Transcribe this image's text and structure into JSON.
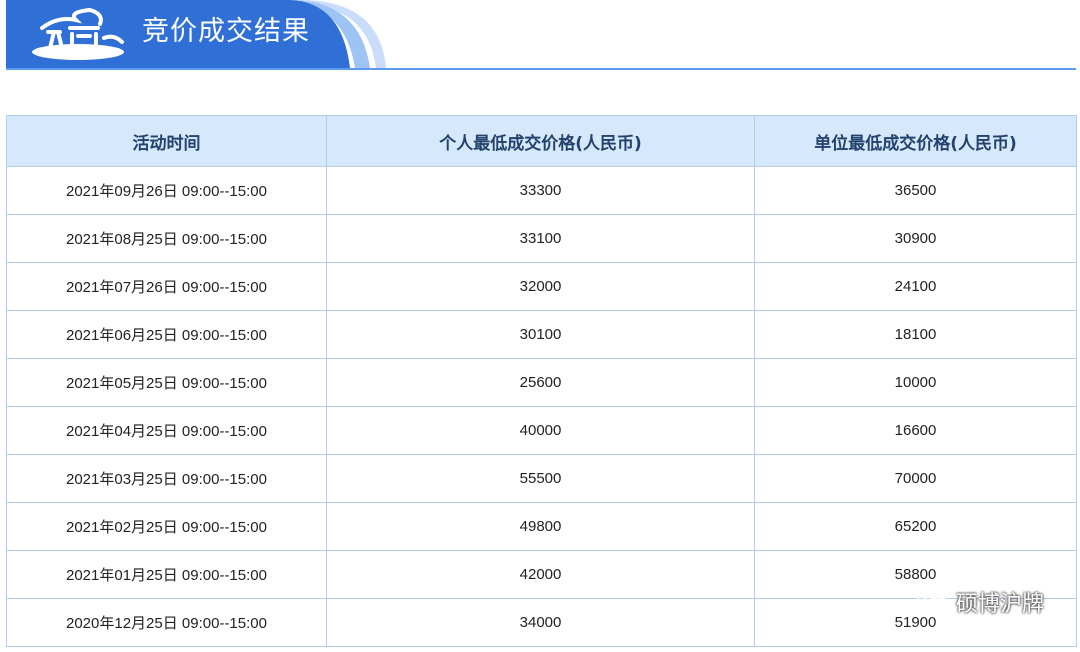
{
  "header": {
    "title": "竞价成交结果"
  },
  "table": {
    "columns": [
      "活动时间",
      "个人最低成交价格(人民币)",
      "单位最低成交价格(人民币)"
    ],
    "rows": [
      [
        "2021年09月26日 09:00--15:00",
        "33300",
        "36500"
      ],
      [
        "2021年08月25日 09:00--15:00",
        "33100",
        "30900"
      ],
      [
        "2021年07月26日 09:00--15:00",
        "32000",
        "24100"
      ],
      [
        "2021年06月25日 09:00--15:00",
        "30100",
        "18100"
      ],
      [
        "2021年05月25日 09:00--15:00",
        "25600",
        "10000"
      ],
      [
        "2021年04月25日 09:00--15:00",
        "40000",
        "16600"
      ],
      [
        "2021年03月25日 09:00--15:00",
        "55500",
        "70000"
      ],
      [
        "2021年02月25日 09:00--15:00",
        "49800",
        "65200"
      ],
      [
        "2021年01月25日 09:00--15:00",
        "42000",
        "58800"
      ],
      [
        "2020年12月25日 09:00--15:00",
        "34000",
        "51900"
      ]
    ]
  },
  "watermark": {
    "text": "硕博沪牌",
    "icon": "wechat-icon"
  },
  "colors": {
    "header_blue": "#2f6fd6",
    "header_light": "#9ec4f6",
    "table_header_bg": "#d6e8fb",
    "table_border": "#b4cdee",
    "header_text": "#24426e"
  }
}
